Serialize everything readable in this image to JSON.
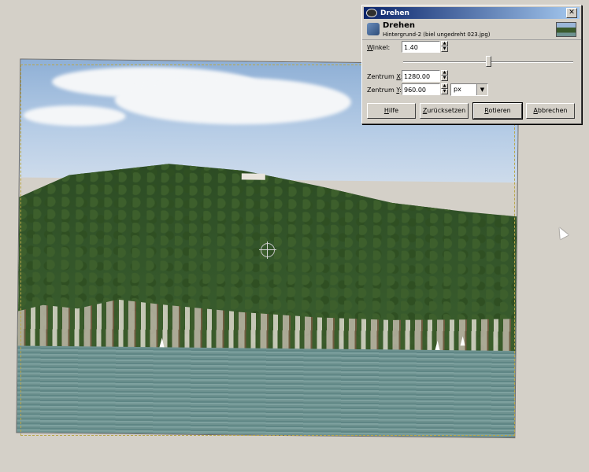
{
  "dialog": {
    "title": "Drehen",
    "header_title": "Drehen",
    "header_subtitle": "Hintergrund-2 (biel ungedreht 023.jpg)",
    "angle": {
      "label_prefix": "",
      "label_mnemonic": "W",
      "label_rest": "inkel:",
      "value": "1.40"
    },
    "center_x": {
      "label_prefix": "Zentrum ",
      "label_mnemonic": "X",
      "label_rest": ":",
      "value": "1280.00"
    },
    "center_y": {
      "label_prefix": "Zentrum ",
      "label_mnemonic": "Y",
      "label_rest": ":",
      "value": "960.00"
    },
    "unit": "px",
    "buttons": {
      "help": {
        "mnemonic": "H",
        "rest": "ilfe"
      },
      "reset": {
        "mnemonic": "Z",
        "rest": "urücksetzen"
      },
      "rotate": {
        "mnemonic": "R",
        "rest": "otieren"
      },
      "cancel": {
        "mnemonic": "A",
        "rest": "bbrechen"
      }
    },
    "close_glyph": "✕",
    "spin_up_glyph": "▲",
    "spin_down_glyph": "▼",
    "dropdown_glyph": "▼"
  },
  "icons": {
    "title": "gimp-eye-icon",
    "tool": "rotate-tool-icon",
    "cursor": "mouse-pointer-icon"
  },
  "colors": {
    "titlebar_start": "#0a246a",
    "titlebar_end": "#a6caf0",
    "window_bg": "#d4d0c8"
  }
}
